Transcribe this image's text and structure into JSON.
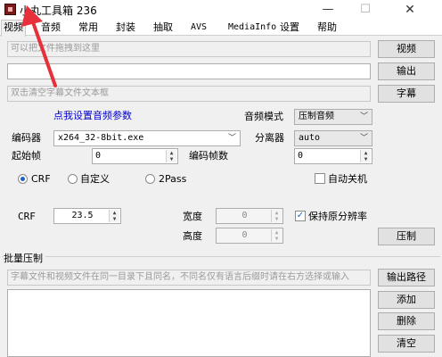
{
  "window": {
    "title": "小丸工具箱 236",
    "minimize": "—",
    "maximize": "☐",
    "close": "✕"
  },
  "tabs": [
    "视频",
    "音频",
    "常用",
    "封装",
    "抽取",
    "AVS",
    "MediaInfo",
    "设置",
    "帮助"
  ],
  "video_tab": {
    "video_input_placeholder": "可以把文件拖拽到这里",
    "output_value": "",
    "subtitle_placeholder": "双击清空字幕文件文本框",
    "btn_video": "视频",
    "btn_output": "输出",
    "btn_subtitle": "字幕",
    "audio_settings_link": "点我设置音频参数",
    "audio_mode_label": "音频模式",
    "audio_mode_value": "压制音频",
    "encoder_label": "编码器",
    "encoder_value": "x264_32-8bit.exe",
    "demuxer_label": "分离器",
    "demuxer_value": "auto",
    "start_frame_label": "起始帧",
    "start_frame_value": "0",
    "encode_frames_label": "编码帧数",
    "encode_frames_value": "0",
    "mode_crf": "CRF",
    "mode_custom": "自定义",
    "mode_2pass": "2Pass",
    "auto_shutdown": "自动关机",
    "crf_label": "CRF",
    "crf_value": "23.5",
    "width_label": "宽度",
    "width_value": "0",
    "height_label": "高度",
    "height_value": "0",
    "keep_resolution": "保持原分辨率",
    "keep_resolution_checked": true,
    "btn_encode": "压制"
  },
  "batch": {
    "title": "批量压制",
    "hint": "字幕文件和视频文件在同一目录下且同名，不同名仅有语言后缀时请在右方选择或输入",
    "btn_output_path": "输出路径",
    "btn_add": "添加",
    "btn_delete": "删除",
    "btn_clear": "清空"
  },
  "colors": {
    "annotation_arrow": "#e8303a",
    "link": "#0000cc",
    "check_accent": "#1a64c8"
  }
}
